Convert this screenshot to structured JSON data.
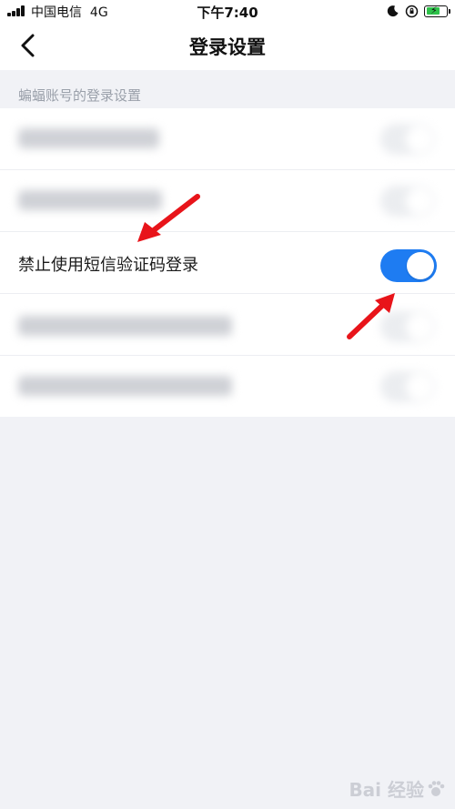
{
  "status_bar": {
    "carrier": "中国电信",
    "network": "4G",
    "time": "下午7:40"
  },
  "nav": {
    "title": "登录设置",
    "back_icon": "chevron-left-icon"
  },
  "section": {
    "header": "蝙蝠账号的登录设置"
  },
  "settings": [
    {
      "label": "",
      "toggle_on": false,
      "blurred": true
    },
    {
      "label": "",
      "toggle_on": false,
      "blurred": true
    },
    {
      "label": "禁止使用短信验证码登录",
      "toggle_on": true,
      "blurred": false
    },
    {
      "label": "",
      "toggle_on": false,
      "blurred": true
    },
    {
      "label": "",
      "toggle_on": false,
      "blurred": true
    }
  ],
  "colors": {
    "accent": "#1e7cf2",
    "background": "#f1f2f6",
    "annotation_arrow": "#e8141a"
  },
  "watermark": {
    "text": "Bai 经验"
  }
}
